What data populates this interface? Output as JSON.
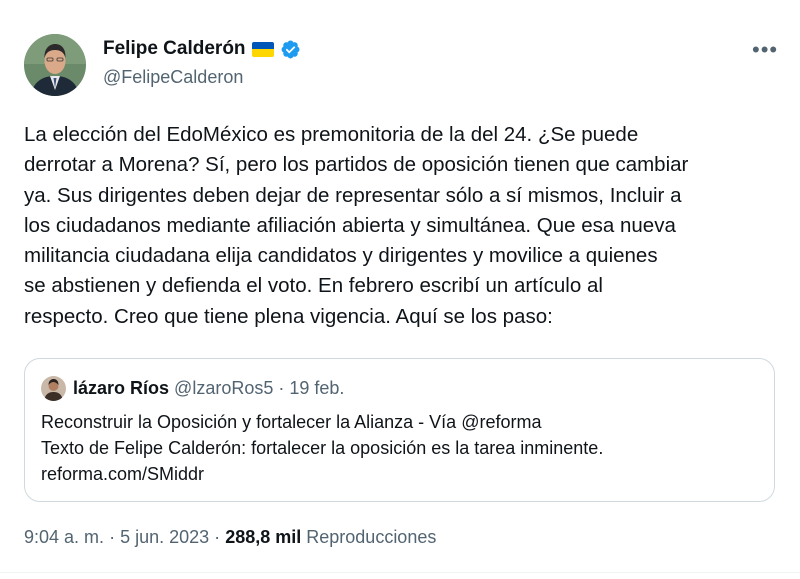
{
  "author": {
    "display_name": "Felipe Calderón",
    "handle": "@FelipeCalderon",
    "flag_icon": "ukraine-flag-icon",
    "verified_icon": "verified-badge-icon"
  },
  "tweet": {
    "lines": [
      "La elección del EdoMéxico es premonitoria de la del 24. ¿Se puede",
      "derrotar a Morena? Sí, pero los partidos de oposición tienen que cambiar",
      "ya. Sus dirigentes deben dejar de representar sólo a sí mismos, Incluir a",
      "los ciudadanos  mediante afiliación abierta y simultánea. Que esa nueva",
      "militancia ciudadana  elija candidatos y dirigentes y movilice a quienes",
      "se abstienen y defienda el voto. En febrero escribí un artículo al",
      "respecto. Creo que tiene plena vigencia. Aquí se los paso:"
    ]
  },
  "quote": {
    "name": "lázaro Ríos",
    "handle": "@lzaroRos5",
    "separator": "·",
    "date": "19 feb.",
    "lines": [
      "Reconstruir la Oposición y fortalecer la Alianza - Vía @reforma",
      "Texto de Felipe Calderón: fortalecer la oposición es la tarea inminente.",
      "reforma.com/SMiddr"
    ]
  },
  "meta": {
    "time": "9:04 a. m.",
    "separator": "·",
    "date": "5 jun. 2023",
    "views": "288,8 mil",
    "views_label": "Reproducciones"
  },
  "more_icon": "more-options-icon",
  "colors": {
    "text": "#0f1419",
    "secondary": "#536471",
    "verified": "#1d9bf0",
    "border": "#cfd9de"
  }
}
